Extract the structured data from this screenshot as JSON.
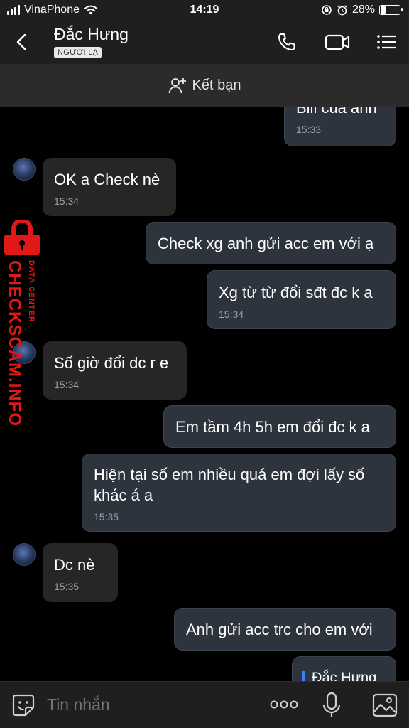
{
  "status_bar": {
    "carrier": "VinaPhone",
    "time": "14:19",
    "battery_percent": "28%",
    "battery_level": 0.28,
    "icons": [
      "wifi-icon",
      "orientation-lock-icon",
      "alarm-icon",
      "battery-icon"
    ]
  },
  "header": {
    "contact_name": "Đắc Hưng",
    "badge": "NGƯỜI LẠ",
    "icons": [
      "back-icon",
      "phone-icon",
      "video-call-icon",
      "menu-icon"
    ]
  },
  "add_friend": {
    "label": "Kết bạn",
    "icon": "add-user-icon"
  },
  "messages": [
    {
      "dir": "out",
      "text": "Bill của anh",
      "time": "15:33"
    },
    {
      "dir": "in",
      "text": "OK a Check nè",
      "time": "15:34"
    },
    {
      "dir": "out",
      "text": "Check xg anh gửi acc em với ạ",
      "time": ""
    },
    {
      "dir": "out",
      "text": "Xg từ từ đổi sđt đc k a",
      "time": "15:34"
    },
    {
      "dir": "in",
      "text": "Số giờ đổi dc r e",
      "time": "15:34"
    },
    {
      "dir": "out",
      "text": "Em tầm 4h 5h em đổi đc k a",
      "time": ""
    },
    {
      "dir": "out",
      "text": "Hiện tại số em nhiều quá em đợi lấy số khác á a",
      "time": "15:35"
    },
    {
      "dir": "in",
      "text": "Dc nè",
      "time": "15:35"
    },
    {
      "dir": "out",
      "text": "Anh gửi acc trc cho em với",
      "time": ""
    },
    {
      "dir": "out",
      "text": "Đắc Hưng",
      "time": ""
    }
  ],
  "watermark": {
    "main": "CHECKSCAM.INFO",
    "sub": "DATA CENTER",
    "color": "#e01818"
  },
  "input": {
    "placeholder": "Tin nhắn",
    "icons": [
      "sticker-icon",
      "more-icon",
      "microphone-icon",
      "image-icon"
    ]
  },
  "colors": {
    "incoming_bubble": "#262626",
    "outgoing_bubble": "#2d343d",
    "accent": "#3b82f6"
  }
}
